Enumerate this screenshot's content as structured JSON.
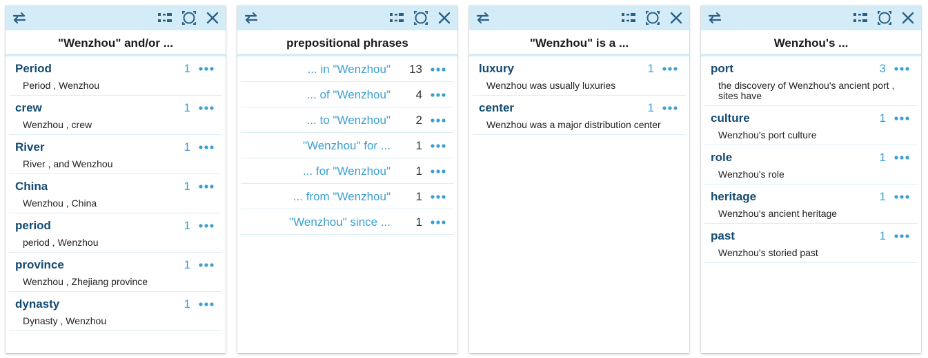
{
  "icons": {
    "swap": "swap-arrows-icon",
    "view": "list-view-icon",
    "focus": "focus-icon",
    "close": "close-icon",
    "more": "more-dots-icon"
  },
  "colors": {
    "toolbar_bg": "#d3ecf7",
    "word": "#134a72",
    "accent": "#3a9fd2",
    "icon": "#2a5f86"
  },
  "panels": [
    {
      "title": "\"Wenzhou\" and/or ...",
      "items": [
        {
          "word": "Period",
          "count": "1",
          "example": "Period , Wenzhou"
        },
        {
          "word": "crew",
          "count": "1",
          "example": "Wenzhou , crew"
        },
        {
          "word": "River",
          "count": "1",
          "example": "River , and Wenzhou"
        },
        {
          "word": "China",
          "count": "1",
          "example": "Wenzhou , China"
        },
        {
          "word": "period",
          "count": "1",
          "example": "period , Wenzhou"
        },
        {
          "word": "province",
          "count": "1",
          "example": "Wenzhou , Zhejiang province"
        },
        {
          "word": "dynasty",
          "count": "1",
          "example": "Dynasty , Wenzhou"
        }
      ]
    },
    {
      "title": "prepositional phrases",
      "items": [
        {
          "label": "... in \"Wenzhou\"",
          "count": "13"
        },
        {
          "label": "... of \"Wenzhou\"",
          "count": "4"
        },
        {
          "label": "... to \"Wenzhou\"",
          "count": "2"
        },
        {
          "label": "\"Wenzhou\" for ...",
          "count": "1"
        },
        {
          "label": "... for \"Wenzhou\"",
          "count": "1"
        },
        {
          "label": "... from \"Wenzhou\"",
          "count": "1"
        },
        {
          "label": "\"Wenzhou\" since ...",
          "count": "1"
        }
      ]
    },
    {
      "title": "\"Wenzhou\" is a ...",
      "items": [
        {
          "word": "luxury",
          "count": "1",
          "example": "Wenzhou was usually luxuries"
        },
        {
          "word": "center",
          "count": "1",
          "example": "Wenzhou was a major distribution center"
        }
      ]
    },
    {
      "title": "Wenzhou's ...",
      "items": [
        {
          "word": "port",
          "count": "3",
          "example": "the discovery of Wenzhou's ancient port , sites have"
        },
        {
          "word": "culture",
          "count": "1",
          "example": "Wenzhou's port culture"
        },
        {
          "word": "role",
          "count": "1",
          "example": "Wenzhou's role"
        },
        {
          "word": "heritage",
          "count": "1",
          "example": "Wenzhou's ancient heritage"
        },
        {
          "word": "past",
          "count": "1",
          "example": "Wenzhou's storied past"
        }
      ]
    }
  ]
}
